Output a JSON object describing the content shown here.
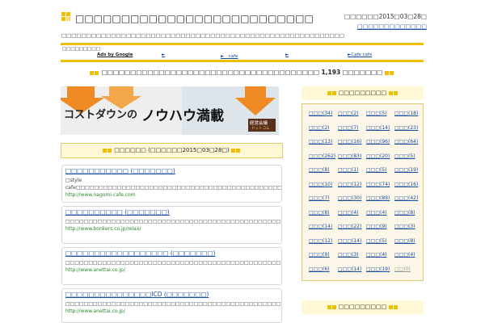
{
  "header": {
    "site_title": "□□□□□□□□□□□□□□□□□□□□□□□□□□",
    "tagline": "□□□□□□□□□□□□□□□□□□□□□□□□□□□□□□□□□□□□□□□□□□□□□□□□□□□□□□□□□",
    "date_label": "□□□□□□2015□03□28□",
    "top_link": "□□□□□□□□□□□□□"
  },
  "adbar": {
    "label": "□□□□□□□□□",
    "ads_by": "Ads by Google",
    "links": [
      "►",
      "►　cafe",
      "►",
      "►Cafe cafe"
    ]
  },
  "headline": {
    "prefix": "□□□□□□□□□□□□□□□□□□□□□□□□□□□□□□□□□□□□□□",
    "count": "1,193",
    "suffix": "□□□□□□□"
  },
  "banner": {
    "text_left": "コストダウンの",
    "text_main": "ノウハウ満載",
    "badge_top": "経営会議",
    "badge_bottom": "ドットコム"
  },
  "panel": {
    "title": "□□□□□□ (□□□□□□2015□03□28□)"
  },
  "items": [
    {
      "title": "□□□□□□□□□□□ (□□□□□□□)",
      "desc": "□style cafe□□□□□□□□□□□□□□□□□□□□□□□□□□□□□□□□□□□□□□□□□□□□□□□□□□□□□□□□□□□□□□□□□□□□□□□□□□□□□□□□□□□□□□□□□□□□□",
      "url": "http://www.nagomi-cafe.com"
    },
    {
      "title": "□□□□□□□□□□ (□□□□□□□)",
      "desc": "□□□□□□□□□□□□□□□□□□□□□□□□□□□□□□□□□□□□□□□□□□□□□□□□□□□□□□□□□□□□□□□□□□□□□□□□□□□□□□□□□□□□□□□□□□□□□□□□□□□□□□□□□□",
      "url": "http://www.bonkers.co.jp/relax/"
    },
    {
      "title": "□□□□□□□□□□□□□□□□□□ (□□□□□□□)",
      "desc": "□□□□□□□□□□□□□□□□□□□□□□□□□□□□□□□□□□□□□□□□□□□□□□□□□□□□□□□□□□□45□□□□□□□□□□□□□□□□□□□□□□□□□□□□□□□□",
      "url": "http://www.anettai.co.jp/"
    },
    {
      "title": "□□□□□□□□□□□□□□□ICD (□□□□□□□)",
      "desc": "□□□□□□□□□□□□□□□□□□□□□□□□□□□□□□□□□□□□□□□□□□□□□□□□□□□□□□□□□□□44□□□□□□□□□□□□□□□□□□□□□□□□□□□□□□□□",
      "url": "http://www.anettai.co.jp/"
    }
  ],
  "sidebar": {
    "title": "□□□□□□□□□",
    "title2": "□□□□□□□□□",
    "tags": [
      [
        "□□□(34)",
        "□□□(2)",
        "□□□(5)",
        "□□□(18)"
      ],
      [
        "□□□(2)",
        "□□□(7)",
        "□□□(14)",
        "□□□(23)"
      ],
      [
        "□□□(13)",
        "□□□(16)",
        "□□□(96)",
        "□□□(64)"
      ],
      [
        "□□□(262)",
        "□□□(83)",
        "□□□(20)",
        "□□□(5)"
      ],
      [
        "□□□(8)",
        "□□□(1)",
        "□□□(5)",
        "□□□(19)"
      ],
      [
        "□□□(10)",
        "□□□(12)",
        "□□□(74)",
        "□□□(16)"
      ],
      [
        "□□□(7)",
        "□□□(30)",
        "□□□(89)",
        "□□□(42)"
      ],
      [
        "□□□(8)",
        "□□□(4)",
        "□□□(4)",
        "□□□(8)"
      ],
      [
        "□□□(14)",
        "□□□(22)",
        "□□□(9)",
        "□□□(3)"
      ],
      [
        "□□□(12)",
        "□□□(14)",
        "□□□(5)",
        "□□□(8)"
      ],
      [
        "□□□(9)",
        "□□□(3)",
        "□□□(4)",
        "□□□(4)"
      ],
      [
        "□□□(6)",
        "□□□(14)",
        "□□□(19)",
        "□□(0)"
      ]
    ]
  },
  "colors": {
    "accent_yellow": "#f0c000",
    "banner_orange": "#f08a24",
    "link_blue": "#1a4fa0",
    "url_green": "#2a8a2a"
  }
}
